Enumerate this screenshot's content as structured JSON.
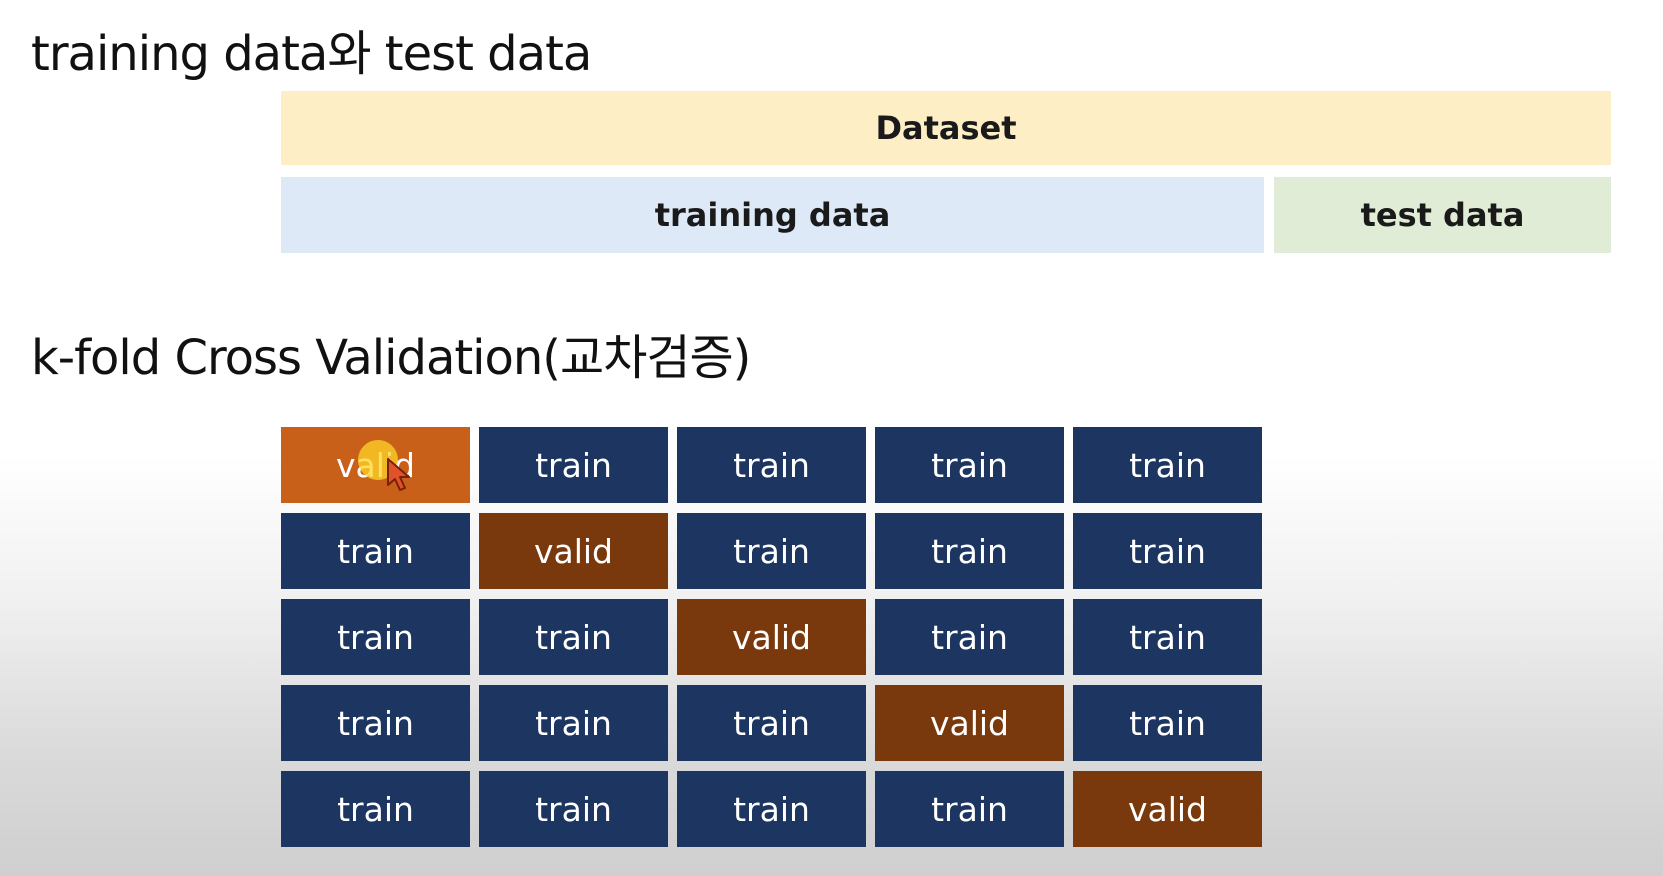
{
  "headings": {
    "split": "training data와 test data",
    "kfold": "k-fold Cross Validation(교차검증)"
  },
  "split_diagram": {
    "dataset_label": "Dataset",
    "training_label": "training data",
    "test_label": "test data"
  },
  "colors": {
    "dataset_fill": "#fdeec6",
    "training_fill": "#dde9f6",
    "test_fill": "#e1ecd6",
    "train_cell": "#1c3561",
    "valid_cell": "#7a390c",
    "valid_cell_active": "#c8601a",
    "cursor_highlight": "#ffd628",
    "cursor_arrow": "#e0532a"
  },
  "kfold_grid": {
    "rows": [
      [
        "valid",
        "train",
        "train",
        "train",
        "train"
      ],
      [
        "train",
        "valid",
        "train",
        "train",
        "train"
      ],
      [
        "train",
        "train",
        "valid",
        "train",
        "train"
      ],
      [
        "train",
        "train",
        "train",
        "valid",
        "train"
      ],
      [
        "train",
        "train",
        "train",
        "train",
        "valid"
      ]
    ],
    "active_cell": [
      0,
      0
    ]
  },
  "pointer": {
    "icon": "cursor-arrow-icon"
  }
}
